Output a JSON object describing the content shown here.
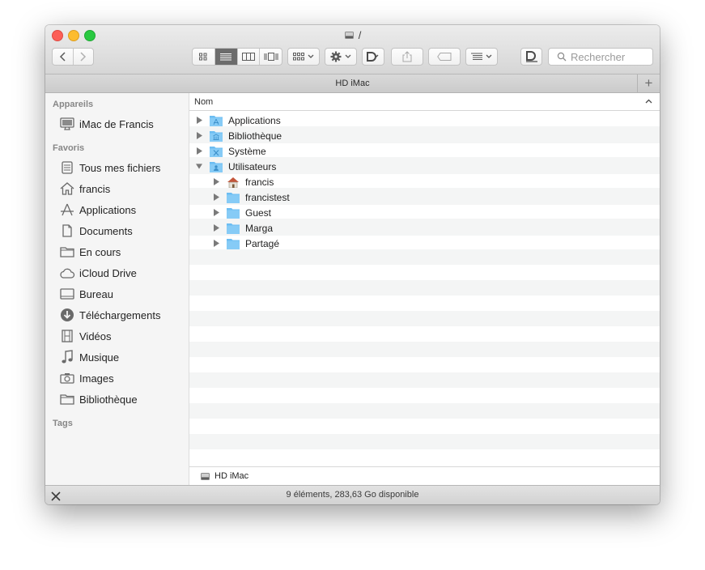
{
  "window": {
    "title": "/"
  },
  "toolbar": {
    "view_modes": [
      "icon-view",
      "list-view",
      "column-view",
      "cover-flow-view"
    ],
    "active_view": "list-view",
    "search_placeholder": "Rechercher"
  },
  "tabbar": {
    "title": "HD iMac",
    "add_label": "+"
  },
  "sidebar": {
    "sections": [
      {
        "header": "Appareils",
        "items": [
          {
            "label": "iMac de Francis",
            "icon": "imac-icon"
          }
        ]
      },
      {
        "header": "Favoris",
        "items": [
          {
            "label": "Tous mes fichiers",
            "icon": "all-files-icon"
          },
          {
            "label": "francis",
            "icon": "home-icon"
          },
          {
            "label": "Applications",
            "icon": "applications-icon"
          },
          {
            "label": "Documents",
            "icon": "documents-icon"
          },
          {
            "label": "En cours",
            "icon": "folder-icon"
          },
          {
            "label": "iCloud Drive",
            "icon": "cloud-icon"
          },
          {
            "label": "Bureau",
            "icon": "desktop-icon"
          },
          {
            "label": "Téléchargements",
            "icon": "download-icon"
          },
          {
            "label": "Vidéos",
            "icon": "film-icon"
          },
          {
            "label": "Musique",
            "icon": "music-icon"
          },
          {
            "label": "Images",
            "icon": "camera-icon"
          },
          {
            "label": "Bibliothèque",
            "icon": "folder-icon"
          }
        ]
      },
      {
        "header": "Tags",
        "items": []
      }
    ]
  },
  "list": {
    "column_name": "Nom",
    "sort_indicator": "^",
    "rows": [
      {
        "name": "Applications",
        "depth": 0,
        "expanded": false,
        "icon": "applications-folder-icon"
      },
      {
        "name": "Bibliothèque",
        "depth": 0,
        "expanded": false,
        "icon": "library-folder-icon"
      },
      {
        "name": "Système",
        "depth": 0,
        "expanded": false,
        "icon": "system-folder-icon"
      },
      {
        "name": "Utilisateurs",
        "depth": 0,
        "expanded": true,
        "icon": "users-folder-icon"
      },
      {
        "name": "francis",
        "depth": 1,
        "expanded": false,
        "icon": "home-icon"
      },
      {
        "name": "francistest",
        "depth": 1,
        "expanded": false,
        "icon": "folder-icon"
      },
      {
        "name": "Guest",
        "depth": 1,
        "expanded": false,
        "icon": "folder-icon"
      },
      {
        "name": "Marga",
        "depth": 1,
        "expanded": false,
        "icon": "folder-icon"
      },
      {
        "name": "Partagé",
        "depth": 1,
        "expanded": false,
        "icon": "folder-icon"
      }
    ]
  },
  "pathbar": {
    "label": "HD iMac"
  },
  "status": {
    "text": "9 éléments, 283,63 Go disponible"
  },
  "colors": {
    "folder": "#6cbdf2",
    "selected_segment": "#6c6c6c",
    "alt_row": "#f4f5f5"
  }
}
